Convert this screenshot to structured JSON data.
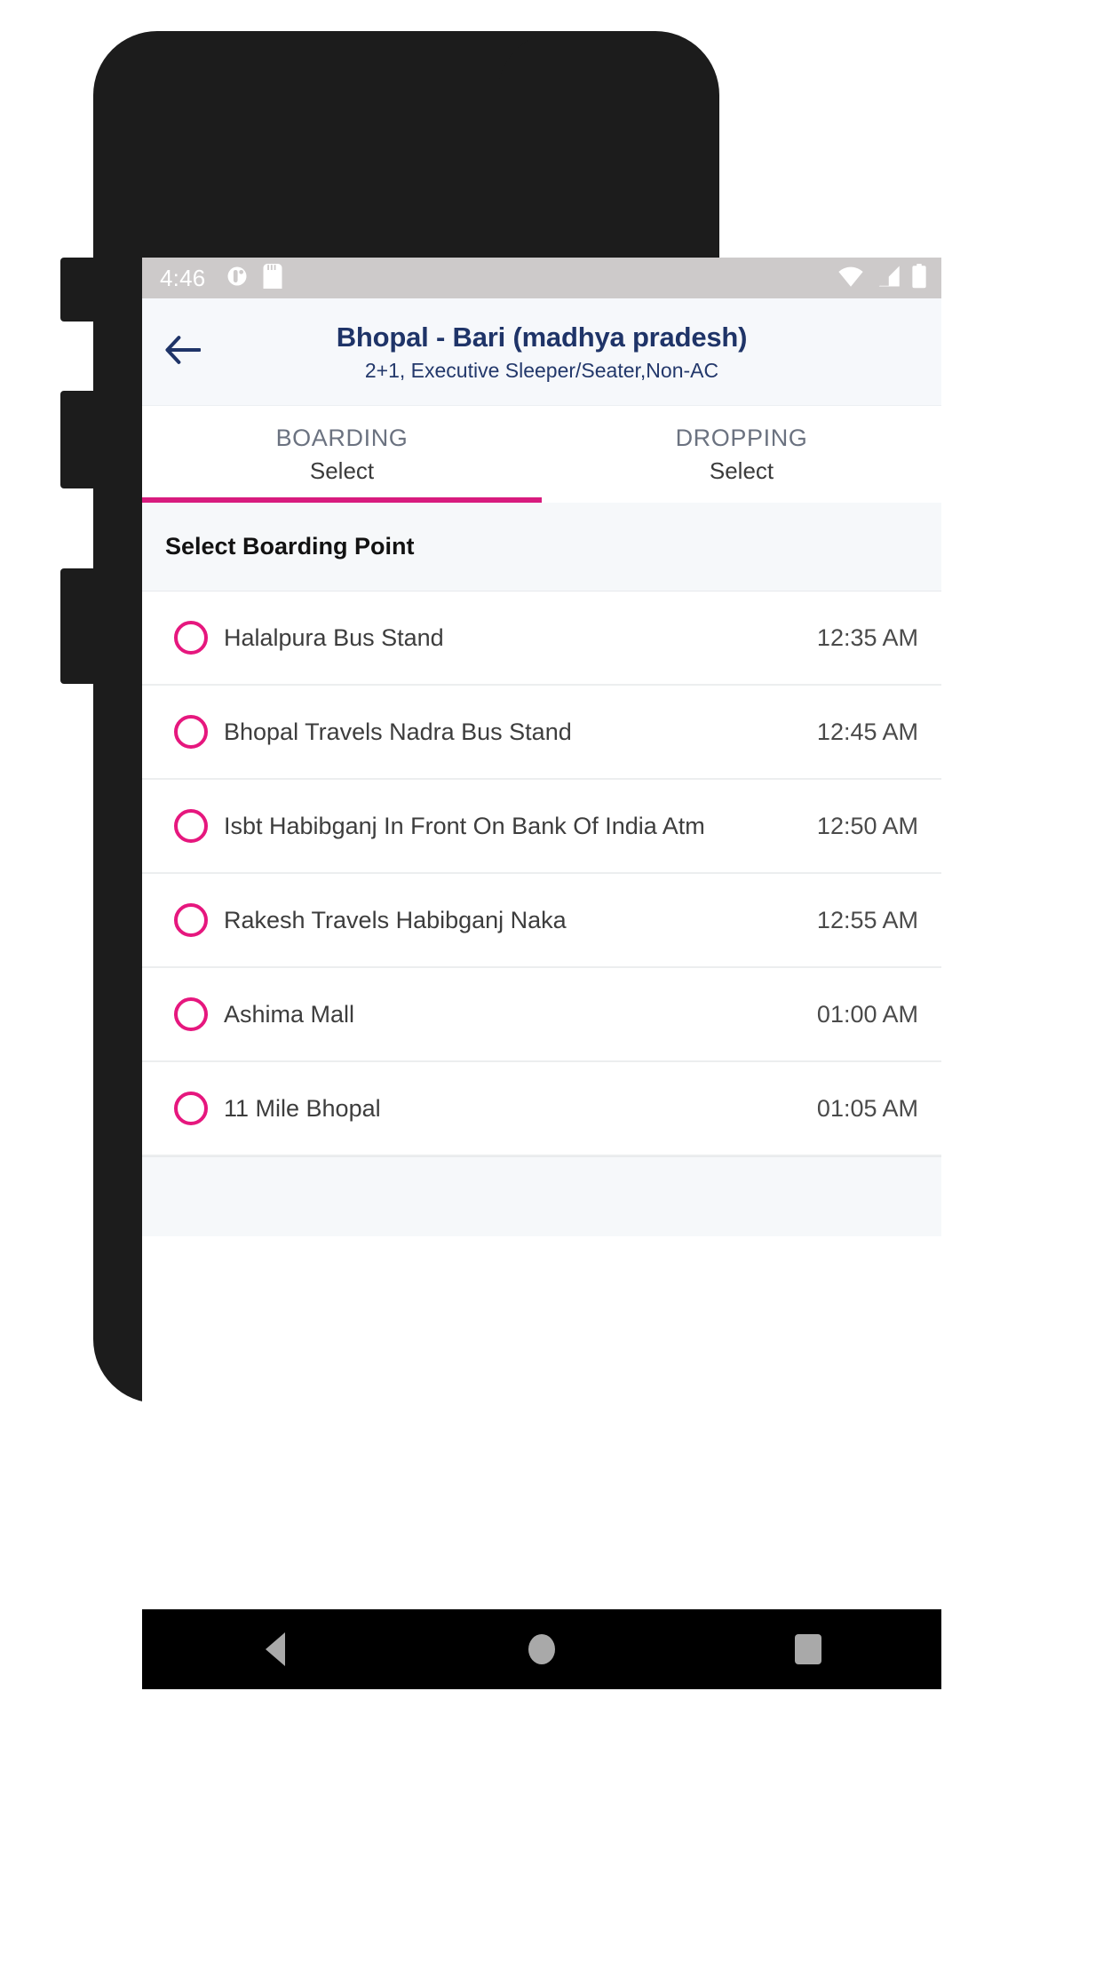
{
  "status_bar": {
    "time": "4:46",
    "left_icons": [
      "android-debug-icon",
      "sd-card-icon"
    ],
    "right_icons": [
      "wifi-icon",
      "cellular-signal-icon",
      "battery-icon"
    ]
  },
  "header": {
    "back_icon": "back-arrow-icon",
    "title": "Bhopal - Bari (madhya pradesh)",
    "subtitle": "2+1, Executive Sleeper/Seater,Non-AC"
  },
  "tabs": [
    {
      "label": "BOARDING",
      "value": "Select",
      "active": true
    },
    {
      "label": "DROPPING",
      "value": "Select",
      "active": false
    }
  ],
  "section": {
    "title": "Select Boarding Point"
  },
  "points": [
    {
      "name": "Halalpura Bus Stand",
      "time": "12:35 AM"
    },
    {
      "name": "Bhopal Travels Nadra Bus Stand",
      "time": "12:45 AM"
    },
    {
      "name": "Isbt Habibganj In Front On Bank Of India Atm",
      "time": "12:50 AM"
    },
    {
      "name": "Rakesh Travels Habibganj Naka",
      "time": "12:55 AM"
    },
    {
      "name": "Ashima Mall",
      "time": "01:00 AM"
    },
    {
      "name": "11 Mile Bhopal",
      "time": "01:05 AM"
    }
  ],
  "nav_bar": {
    "back": "nav-back-icon",
    "home": "nav-home-icon",
    "recents": "nav-recents-icon"
  },
  "colors": {
    "accent_pink": "#e6177e",
    "title_navy": "#1f3468",
    "status_bar_bg": "#cdcaca",
    "header_bg": "#f6f8fb"
  }
}
